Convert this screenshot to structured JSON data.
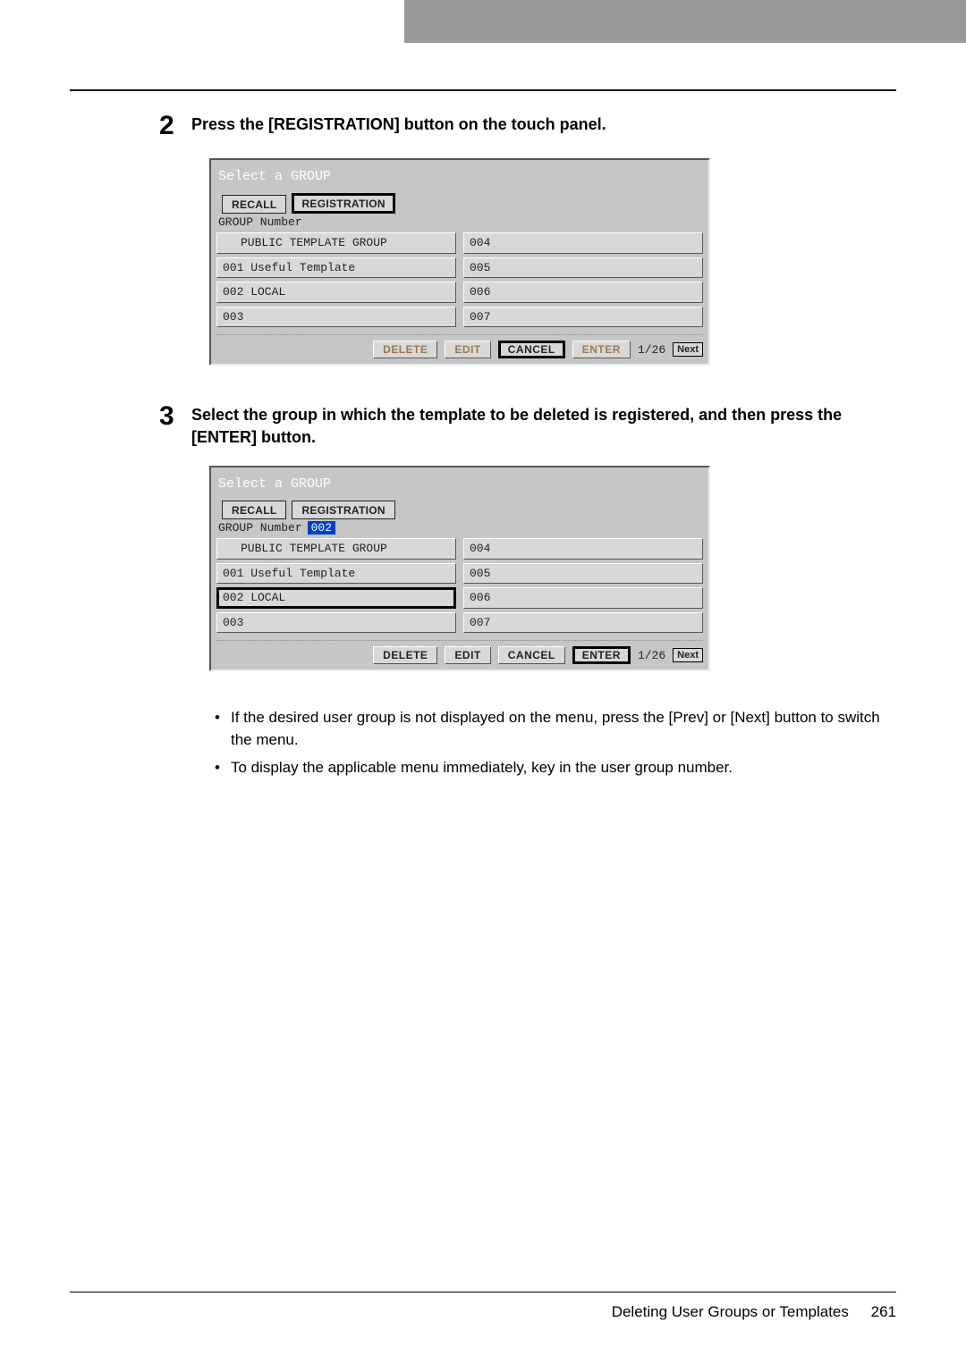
{
  "steps": [
    {
      "number": "2",
      "text": "Press the [REGISTRATION] button on the touch panel."
    },
    {
      "number": "3",
      "text": "Select the group in which the template to be deleted is registered, and then press the [ENTER] button."
    }
  ],
  "panel1": {
    "title": "Select a GROUP",
    "tabs": [
      "RECALL",
      "REGISTRATION"
    ],
    "group_number_label": "GROUP Number",
    "left_items": [
      "PUBLIC TEMPLATE GROUP",
      "001 Useful Template",
      "002 LOCAL",
      "003"
    ],
    "right_items": [
      "004",
      "005",
      "006",
      "007"
    ],
    "buttons": {
      "delete": "DELETE",
      "edit": "EDIT",
      "cancel": "CANCEL",
      "enter": "ENTER",
      "next": "Next"
    },
    "page_indicator": "1/26"
  },
  "panel2": {
    "title": "Select a GROUP",
    "tabs": [
      "RECALL",
      "REGISTRATION"
    ],
    "group_number_label": "GROUP Number",
    "group_number_value": "002",
    "left_items": [
      "PUBLIC TEMPLATE GROUP",
      "001 Useful Template",
      "002 LOCAL",
      "003"
    ],
    "right_items": [
      "004",
      "005",
      "006",
      "007"
    ],
    "buttons": {
      "delete": "DELETE",
      "edit": "EDIT",
      "cancel": "CANCEL",
      "enter": "ENTER",
      "next": "Next"
    },
    "page_indicator": "1/26"
  },
  "notes": [
    "If the desired user group is not displayed on the menu, press the [Prev] or [Next] button to switch the menu.",
    "To display the applicable menu immediately, key in the user group number."
  ],
  "footer": {
    "title": "Deleting User Groups or Templates",
    "page": "261"
  }
}
